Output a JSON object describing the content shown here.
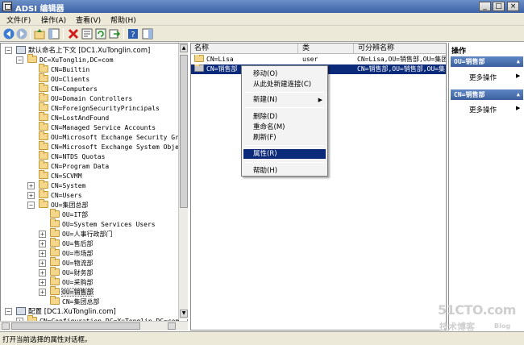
{
  "window": {
    "title": "ADSI 编辑器",
    "controls": [
      "_",
      "□",
      "×"
    ]
  },
  "menubar": [
    {
      "label": "文件(F)"
    },
    {
      "label": "操作(A)"
    },
    {
      "label": "查看(V)"
    },
    {
      "label": "帮助(H)"
    }
  ],
  "toolbar": {
    "icons": [
      "back-icon",
      "forward-icon",
      "up-folder-icon",
      "show-tree-icon",
      "delete-icon",
      "properties-icon",
      "refresh-icon",
      "export-icon",
      "help-icon",
      "show-action-pane-icon"
    ]
  },
  "tree": {
    "root1": "默认命名上下文 [DC1.XuTonglin.com]",
    "domain": "DC=XuTonglin,DC=com",
    "items": [
      "CN=Builtin",
      "OU=Clients",
      "CN=Computers",
      "OU=Domain Controllers",
      "CN=ForeignSecurityPrincipals",
      "CN=LostAndFound",
      "CN=Managed Service Accounts",
      "OU=Microsoft Exchange Security Grou",
      "CN=Microsoft Exchange System Object",
      "CN=NTDS Quotas",
      "CN=Program Data",
      "CN=SCVMM",
      "CN=System",
      "CN=Users",
      "OU=集团总部"
    ],
    "subitems": [
      "OU=IT部",
      "OU=System Services Users",
      "OU=人事行政部门",
      "OU=售后部",
      "OU=市场部",
      "OU=物流部",
      "OU=财务部",
      "OU=采购部",
      "OU=销售部",
      "CN=集团总部"
    ],
    "root2": "配置 [DC1.XuTonglin.com]",
    "config": "CN=Configuration,DC=XuTonglin,DC=com"
  },
  "list": {
    "columns": [
      "名称",
      "类",
      "可分辨名称"
    ],
    "rows": [
      {
        "name": "CN=Lisa",
        "class": "user",
        "dn": "CN=Lisa,OU=销售部,OU=集团"
      },
      {
        "name": "CN=销售部",
        "class": "",
        "dn": "CN=销售部,OU=销售部,OU=集"
      }
    ]
  },
  "context_menu": {
    "items": [
      {
        "label": "移动(O)"
      },
      {
        "label": "从此处新建连接(C)"
      },
      {
        "label": "新建(N)",
        "submenu": "▶"
      },
      {
        "label": "删除(D)"
      },
      {
        "label": "重命名(M)"
      },
      {
        "label": "刷新(F)"
      },
      {
        "label": "属性(R)"
      },
      {
        "label": "帮助(H)"
      }
    ]
  },
  "actions": {
    "title": "操作",
    "groups": [
      {
        "header": "OU=销售部",
        "item": "更多操作",
        "arrow": "▶"
      },
      {
        "header": "CN=销售部",
        "item": "更多操作",
        "arrow": "▶"
      }
    ],
    "header_arrow": "▲"
  },
  "status": {
    "text": "打开当前选择的属性对话框。"
  },
  "watermark": {
    "line1": "51CTO.com",
    "line2": "技术博客",
    "line3": "Blog"
  },
  "colors": {
    "selection": "#0b2a7a",
    "titlebar": "#3d63a8",
    "action_header": "#3b5f9e"
  }
}
